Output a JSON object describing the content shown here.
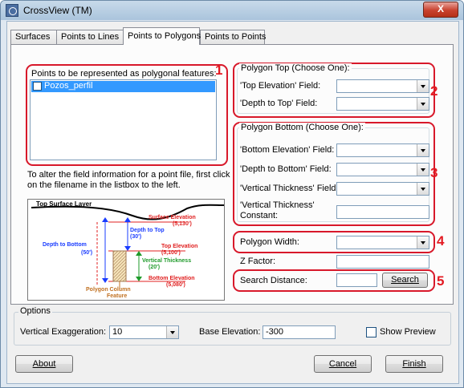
{
  "window": {
    "title": "CrossView (TM)",
    "close": "X"
  },
  "tabs": [
    "Surfaces",
    "Points to Lines",
    "Points to Polygons",
    "Points to Points"
  ],
  "points": {
    "label": "Points to be represented as polygonal features:",
    "items": [
      {
        "name": "Pozos_perfil",
        "checked": false
      }
    ],
    "help": "To alter the field information for a point file, first click on the filename in the listbox to the left."
  },
  "polygon_top": {
    "legend": "Polygon Top (Choose One):",
    "fields": [
      "'Top Elevation' Field:",
      "'Depth to Top' Field:"
    ]
  },
  "polygon_bottom": {
    "legend": "Polygon Bottom (Choose One):",
    "fields": [
      "'Bottom Elevation' Field:",
      "'Depth to Bottom' Field:",
      "'Vertical Thickness' Field:"
    ],
    "constant_label": "'Vertical Thickness' Constant:"
  },
  "polygon_width": {
    "label": "Polygon Width:"
  },
  "z_factor": {
    "label": "Z Factor:"
  },
  "search": {
    "label": "Search Distance:",
    "button": "Search"
  },
  "badges": [
    "1",
    "2",
    "3",
    "4",
    "5"
  ],
  "diagram": {
    "top_surface": "Top Surface Layer",
    "surface_elev": "Surface Elevation",
    "surface_elev_val": "(5,130')",
    "depth_to_top": "Depth to Top",
    "depth_to_top_val": "(30')",
    "top_elev": "Top Elevation",
    "top_elev_val": "(5,100')",
    "depth_to_bottom": "Depth to Bottom",
    "depth_to_bottom_val": "(50')",
    "vert_thick": "Vertical Thickness",
    "vert_thick_val": "(20')",
    "bottom_elev": "Bottom Elevation",
    "bottom_elev_val": "(5,080')",
    "poly_col": "Polygon Column",
    "feature": "Feature"
  },
  "options": {
    "legend": "Options",
    "vert_exag_label": "Vertical Exaggeration:",
    "vert_exag_value": "10",
    "base_elev_label": "Base Elevation:",
    "base_elev_value": "-300",
    "show_preview": "Show Preview"
  },
  "buttons": {
    "about": "About",
    "cancel": "Cancel",
    "finish": "Finish"
  }
}
